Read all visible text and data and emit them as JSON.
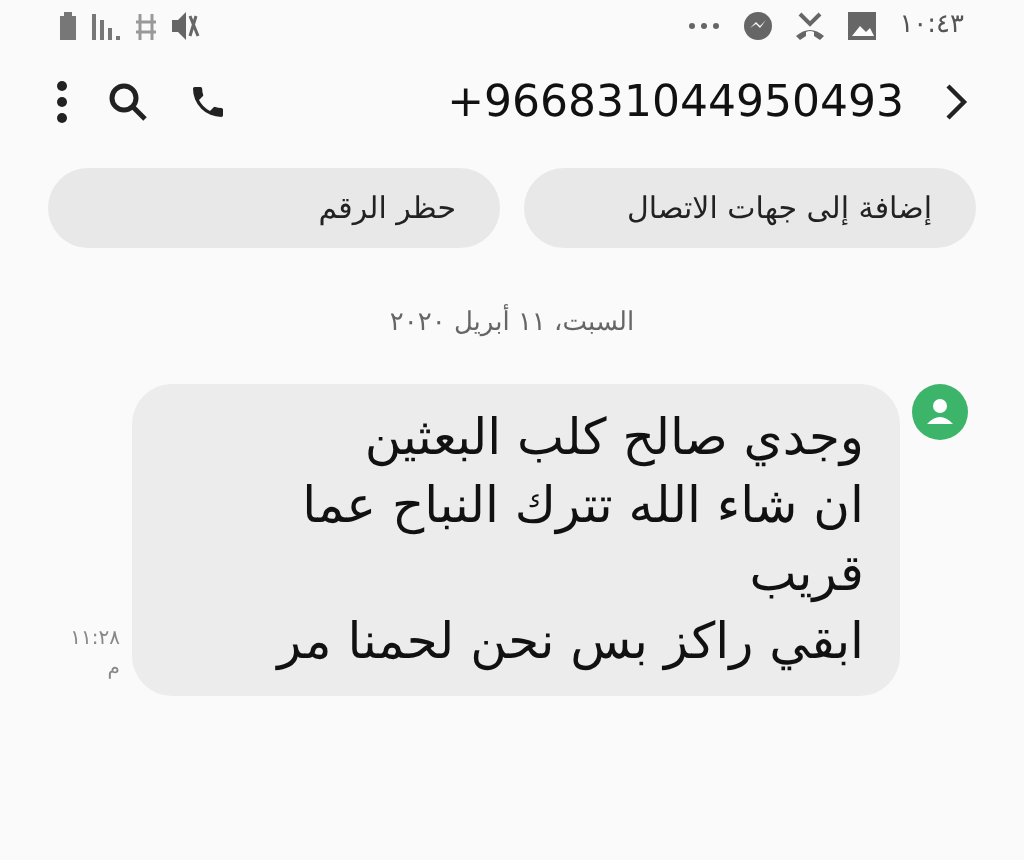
{
  "status_bar": {
    "time": "١٠:٤٣"
  },
  "header": {
    "phone_number": "+966831044950493"
  },
  "actions": [
    {
      "label": "إضافة إلى جهات الاتصال"
    },
    {
      "label": "حظر الرقم"
    }
  ],
  "date_divider": "السبت، ١١ أبريل ٢٠٢٠",
  "messages": [
    {
      "lines": [
        "وجدي صالح كلب البعثين",
        "ان شاء الله تترك النباح عما",
        "قريب",
        "ابقي راكز بس نحن لحمنا مر"
      ],
      "time": "١١:٢٨ م"
    }
  ]
}
